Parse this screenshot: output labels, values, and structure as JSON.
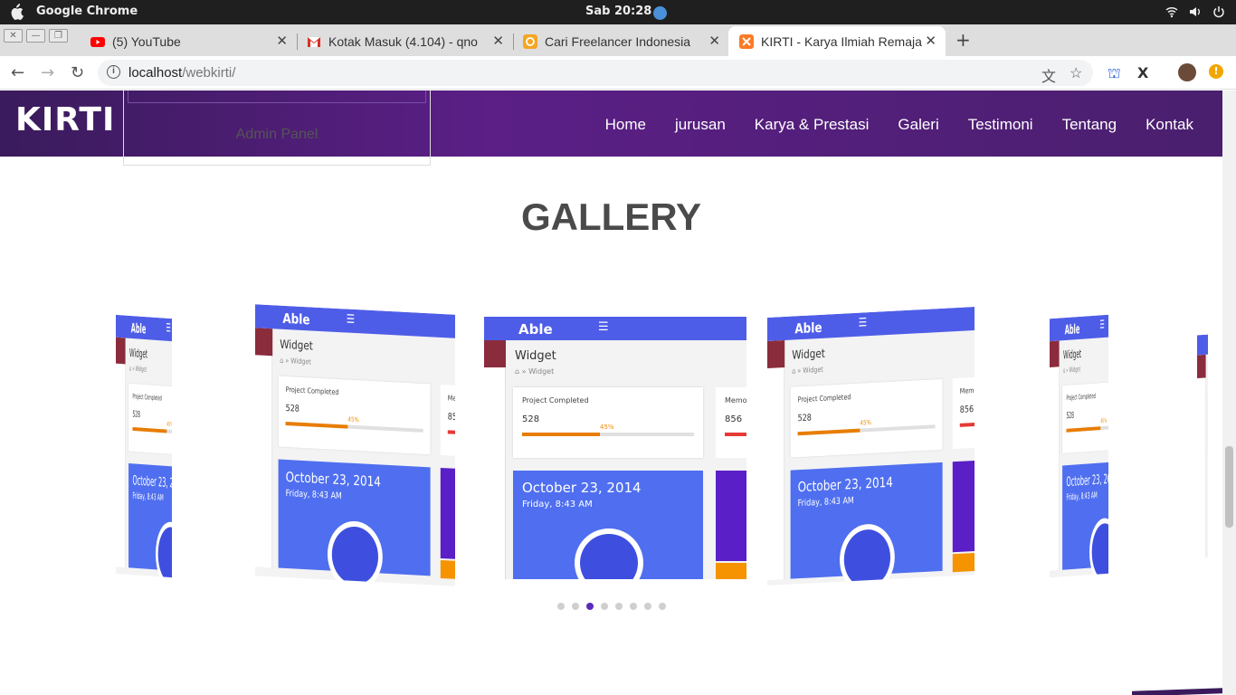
{
  "os": {
    "app_name": "Google Chrome",
    "clock": "Sab 20:28"
  },
  "browser": {
    "tabs": [
      {
        "title": "(5) YouTube",
        "favicon": "youtube-icon",
        "color": "#ff0000"
      },
      {
        "title": "Kotak Masuk (4.104) - qno",
        "favicon": "gmail-icon",
        "color": "#d93025"
      },
      {
        "title": "Cari Freelancer Indonesia",
        "favicon": "freelancer-icon",
        "color": "#f5a623"
      },
      {
        "title": "KIRTI - Karya Ilmiah Remaja",
        "favicon": "xampp-icon",
        "color": "#fb7a24"
      }
    ],
    "active_tab": 3,
    "url_host": "localhost",
    "url_path": "/webkirti/"
  },
  "site": {
    "brand": "KIRTI",
    "menu": [
      "Home",
      "jurusan",
      "Karya & Prestasi",
      "Galeri",
      "Testimoni",
      "Tentang",
      "Kontak"
    ],
    "admin_panel": "Admin Panel",
    "gallery_title": "GALLERY",
    "colors": {
      "nav_start": "#3a1b5c",
      "nav_mid": "#5b1f86",
      "accent": "#5a2ab8"
    }
  },
  "slide": {
    "logo": "Able",
    "widget_title": "Widget",
    "crumb": "Widget",
    "card_title": "Project Completed",
    "card_value": "528",
    "card_percent": "45%",
    "card_progress": 0.45,
    "card2_title": "Memo",
    "card2_value": "856",
    "date": "October 23, 2014",
    "time": "Friday, 8:43 AM"
  },
  "carousel": {
    "dot_count": 8,
    "active_dot": 2
  }
}
